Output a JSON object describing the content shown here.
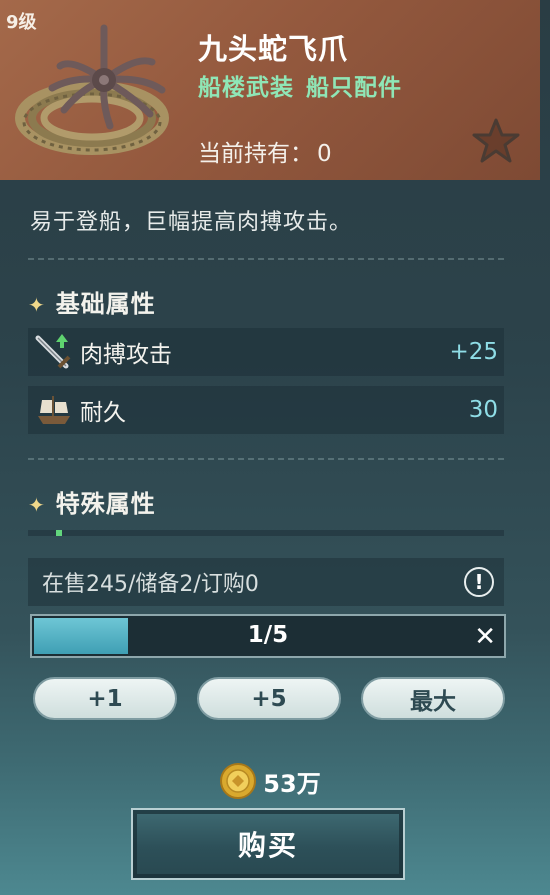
{
  "item": {
    "level": "9级",
    "name": "九头蛇飞爪",
    "tags": [
      "船楼武装",
      "船只配件"
    ],
    "owned_label": "当前持有：",
    "owned_count": "0",
    "description": "易于登船，巨幅提高肉搏攻击。"
  },
  "basic_section": {
    "title": "基础属性",
    "attributes": [
      {
        "label": "肉搏攻击",
        "value": "+25",
        "icon": "sword-icon"
      },
      {
        "label": "耐久",
        "value": "30",
        "icon": "ship-icon"
      }
    ]
  },
  "special_section": {
    "title": "特殊属性"
  },
  "market": {
    "stock_text": "在售245/储备2/订购0",
    "quantity_text": "1/5",
    "quantity_fraction": 0.2,
    "buttons": [
      "+1",
      "+5",
      "最大"
    ],
    "price": "53万",
    "buy_label": "购买"
  },
  "colors": {
    "header_bg": "#9a5f43",
    "tag_green": "#8fe6b6",
    "value_cyan": "#8fdde6",
    "bar_fill": "#4fb0c4"
  }
}
